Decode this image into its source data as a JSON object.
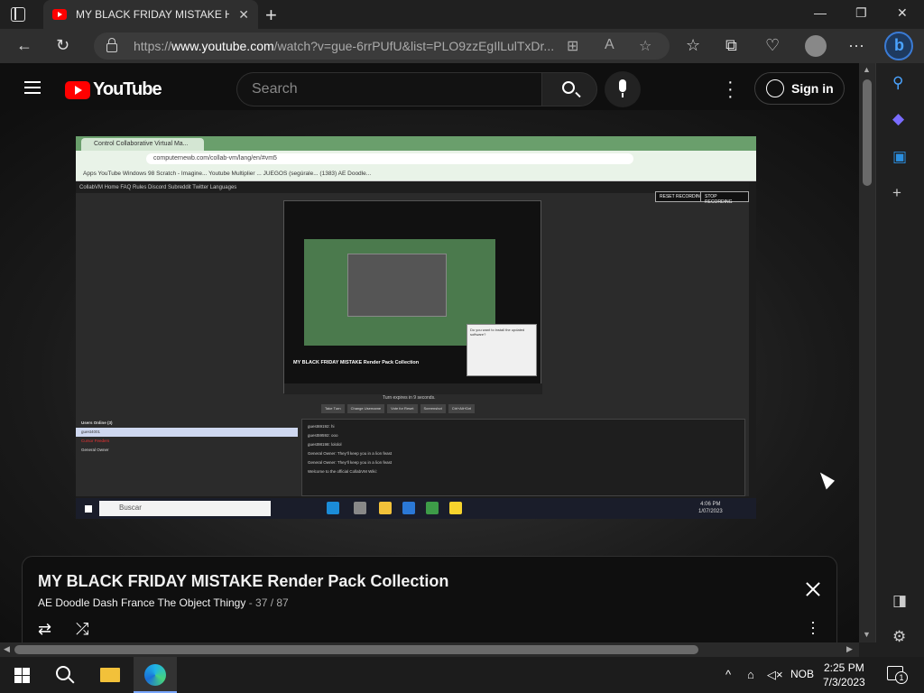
{
  "browser": {
    "tab_title": "MY BLACK FRIDAY MISTAKE Has",
    "url_prefix": "https://",
    "url_domain": "www.youtube.com",
    "url_rest": "/watch?v=gue-6rrPUfU&list=PLO9zzEgIlLulTxDr..."
  },
  "youtube": {
    "logo_text": "YouTube",
    "search_placeholder": "Search",
    "sign_in_label": "Sign in"
  },
  "video_frame": {
    "tab_title": "Control Collaborative Virtual Ma...",
    "url": "computernewb.com/collab-vm/lang/en/#vm5",
    "bookmarks": "Apps   YouTube   Windows 98   Scratch - Imagine...   Youtube Multiplier ...   JUEGOS (segúrale...   (1383) AE Doodle...",
    "header_text": "CollabVM   Home   FAQ   Rules   Discord   Subreddit   Twitter   Languages",
    "btn_1": "RESET RECORDING",
    "btn_2": "STOP RECORDING",
    "inner_title": "MY BLACK FRIDAY MISTAKE Render Pack Collection",
    "dialog_text": "Do you want to install the updated software?",
    "caption": "Turn expires in 9 seconds.",
    "buttons": [
      "Take Turn",
      "Change Username",
      "Vote for Reset",
      "Screenshot",
      "Ctrl+Alt+Del"
    ],
    "users_header": "Users Online (3)",
    "users": [
      "guest4001",
      "Cursor Feeders",
      "General Owner"
    ],
    "chat_lines": [
      "guest69192: hi",
      "guest59592: ooo",
      "guest98198: lololol",
      "General Owner: They'll keep you in a lion feast",
      "General Owner: They'll keep you in a lion feast",
      "Welcome to the official CollabVM Wiki:"
    ],
    "search_label": "Buscar",
    "clock_time": "4:06 PM",
    "clock_date": "1/07/2023"
  },
  "playlist": {
    "title": "MY BLACK FRIDAY MISTAKE Render Pack Collection",
    "channel": "AE Doodle Dash France The Object Thingy",
    "position": "- 37 / 87"
  },
  "taskbar": {
    "language": "NOB",
    "time": "2:25 PM",
    "date": "7/3/2023",
    "notification_count": "1"
  }
}
